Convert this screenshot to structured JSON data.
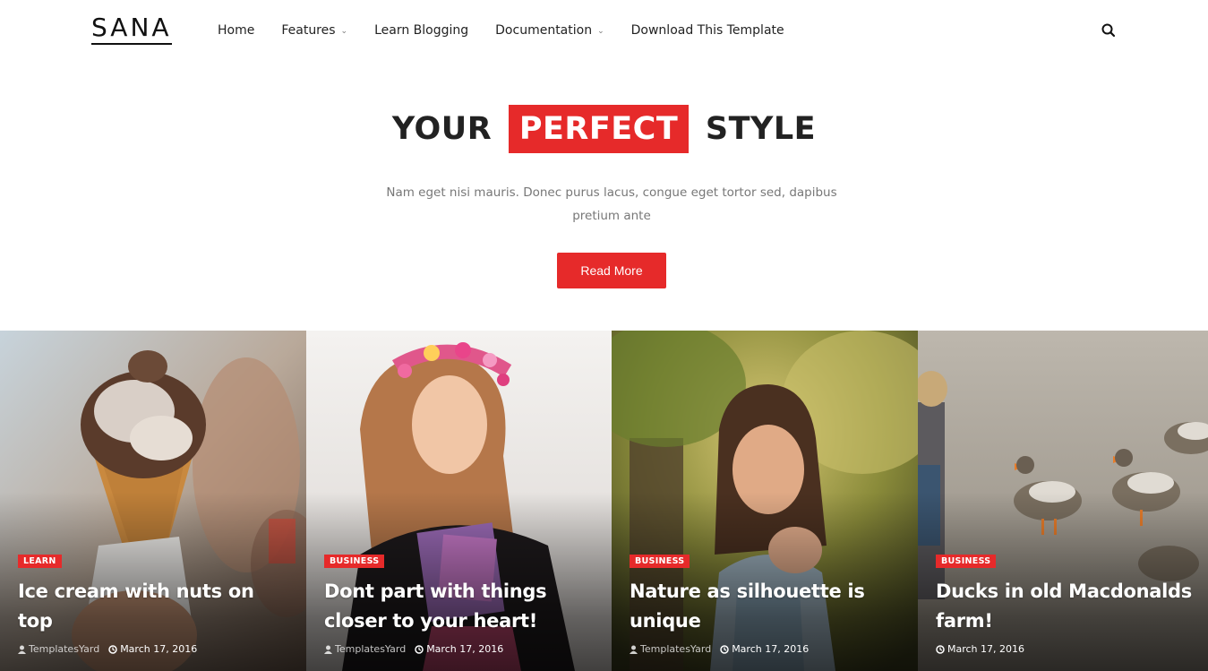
{
  "header": {
    "logo": "SANA",
    "nav": [
      {
        "label": "Home",
        "dropdown": false
      },
      {
        "label": "Features",
        "dropdown": true
      },
      {
        "label": "Learn Blogging",
        "dropdown": false
      },
      {
        "label": "Documentation",
        "dropdown": true
      },
      {
        "label": "Download This Template",
        "dropdown": false
      }
    ],
    "search_icon": "search-icon"
  },
  "hero": {
    "title_before": "YOUR",
    "title_highlight": "PERFECT",
    "title_after": "STYLE",
    "description": "Nam eget nisi mauris. Donec purus lacus, congue eget tortor sed, dapibus pretium ante",
    "button_label": "Read More"
  },
  "colors": {
    "accent": "#e62a2a"
  },
  "cards": [
    {
      "category": "LEARN",
      "title": "Ice cream with nuts on top",
      "author": "TemplatesYard",
      "date": "March 17, 2016"
    },
    {
      "category": "BUSINESS",
      "title": "Dont part with things closer to your heart!",
      "author": "TemplatesYard",
      "date": "March 17, 2016"
    },
    {
      "category": "BUSINESS",
      "title": "Nature as silhouette is unique",
      "author": "TemplatesYard",
      "date": "March 17, 2016"
    },
    {
      "category": "BUSINESS",
      "title": "Ducks in old Macdonalds farm!",
      "author": "",
      "date": "March 17, 2016"
    }
  ]
}
